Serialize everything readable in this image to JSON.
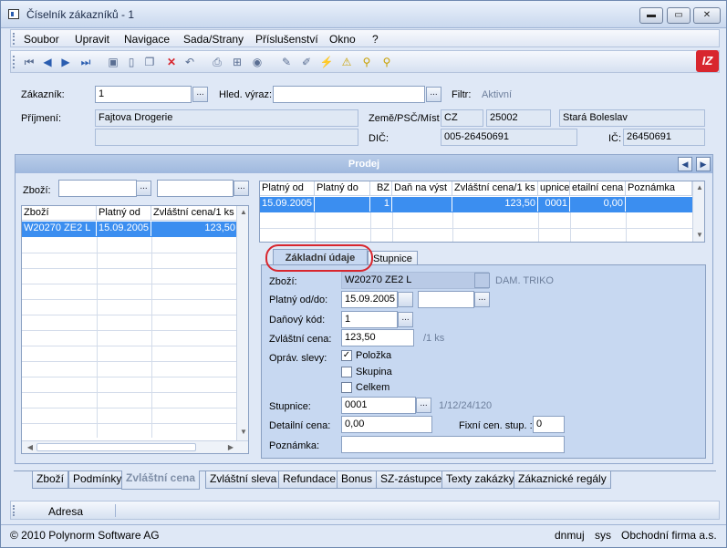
{
  "window": {
    "title": "Číselník zákazníků - 1",
    "min": "▬",
    "max": "▭",
    "close": "✕"
  },
  "menu": [
    "Soubor",
    "Upravit",
    "Navigace",
    "Sada/Strany",
    "Příslušenství",
    "Okno",
    "?"
  ],
  "toolbar_icons": [
    "first-icon",
    "prev-icon",
    "next-icon",
    "last-icon",
    "save-icon",
    "new-icon",
    "copy-icon",
    "delete-icon",
    "undo-icon",
    "print-icon",
    "tree-icon",
    "refresh-icon",
    "edit-icon",
    "edit2-icon",
    "filter-icon",
    "filter-clear-icon",
    "search-icon",
    "search-next-icon"
  ],
  "logo": "IZ",
  "header": {
    "zakaznik_label": "Zákazník:",
    "zakaznik_value": "1",
    "hled_label": "Hled. výraz:",
    "hled_value": "",
    "filtr_label": "Filtr:",
    "filtr_value": "Aktivní",
    "prijmeni_label": "Příjmení:",
    "prijmeni_value": "Fajtova Drogerie",
    "prijmeni2_value": "",
    "zeme_label": "Země/PSČ/Míst",
    "zeme_value": "CZ",
    "psc_value": "25002",
    "misto_value": "Stará Boleslav",
    "dic_label": "DIČ:",
    "dic_value": "005-26450691",
    "ic_label": "IČ:",
    "ic_value": "26450691"
  },
  "panel": {
    "title": "Prodej",
    "prev": "◀",
    "next": "▶"
  },
  "left": {
    "zbozi_label": "Zboží:",
    "zbozi_value": "",
    "zbozi2_value": "",
    "columns": [
      "Zboží",
      "Platný od",
      "Zvláštní cena/1 ks"
    ],
    "rows": [
      [
        "W20270 ZE2 L",
        "15.09.2005",
        "123,50"
      ]
    ]
  },
  "right": {
    "columns": [
      "Platný od",
      "Platný do",
      "BZ",
      "Daň na výst",
      "Zvláštní cena/1 ks",
      "upnice",
      "etailní cena",
      "Poznámka"
    ],
    "rows": [
      [
        "15.09.2005",
        "",
        "1",
        "",
        "123,50",
        "0001",
        "0,00",
        ""
      ]
    ]
  },
  "tabs": [
    "Základní údaje",
    "Stupnice"
  ],
  "detail": {
    "zbozi_label": "Zboží:",
    "zbozi_value": "W20270 ZE2 L",
    "zbozi_desc": "DAM. TRIKO",
    "platny_label": "Platný od/do:",
    "platny_od": "15.09.2005",
    "platny_do": "",
    "dan_label": "Daňový kód:",
    "dan_value": "1",
    "cena_label": "Zvláštní cena:",
    "cena_value": "123,50",
    "cena_unit": "/1 ks",
    "slevy_label": "Opráv. slevy:",
    "checks": [
      {
        "label": "Položka",
        "checked": true
      },
      {
        "label": "Skupina",
        "checked": false
      },
      {
        "label": "Celkem",
        "checked": false
      }
    ],
    "stupnice_label": "Stupnice:",
    "stupnice_value": "0001",
    "stupnice_desc": "1/12/24/120",
    "detail_label": "Detailní cena:",
    "detail_value": "0,00",
    "fixni_label": "Fixní cen. stup. :",
    "fixni_value": "0",
    "poznamka_label": "Poznámka:",
    "poznamka_value": ""
  },
  "bottom_tabs": [
    "Zboží",
    "Podmínky",
    "Zvláštní cena",
    "Zvláštní sleva",
    "Refundace",
    "Bonus",
    "SZ-zástupce",
    "Texty zakázky",
    "Zákaznické regály"
  ],
  "adresa": "Adresa",
  "status": {
    "copyright": "© 2010 Polynorm Software AG",
    "user": "dnmuj",
    "db": "sys",
    "firm": "Obchodní firma a.s."
  }
}
